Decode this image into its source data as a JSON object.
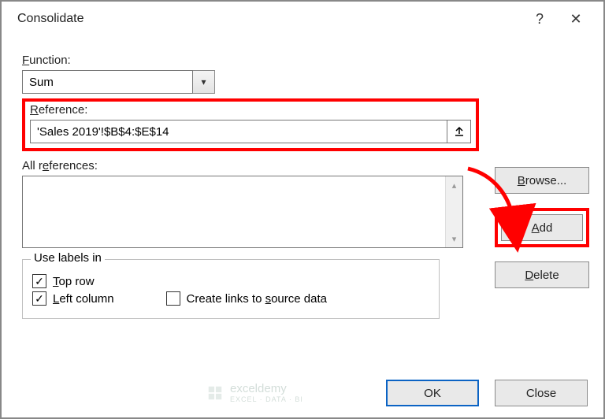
{
  "titlebar": {
    "title": "Consolidate"
  },
  "labels": {
    "function": "Function:",
    "reference": "Reference:",
    "all_references": "All references:",
    "use_labels_in": "Use labels in"
  },
  "function": {
    "value": "Sum"
  },
  "reference": {
    "value": "'Sales 2019'!$B$4:$E$14"
  },
  "buttons": {
    "browse": "Browse...",
    "add": "Add",
    "delete": "Delete",
    "ok": "OK",
    "close": "Close"
  },
  "checkboxes": {
    "top_row": {
      "label": "Top row",
      "checked": true
    },
    "left_column": {
      "label": "Left column",
      "checked": true
    },
    "create_links": {
      "label": "Create links to source data",
      "checked": false
    }
  },
  "watermark": {
    "brand": "exceldemy",
    "tag": "EXCEL · DATA · BI"
  }
}
